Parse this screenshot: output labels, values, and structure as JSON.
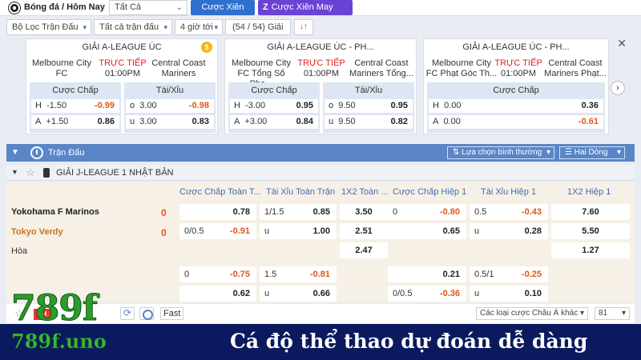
{
  "topbar": {
    "title": "Bóng đá / Hôm Nay",
    "filter_select": "Tất Cả",
    "btn_xien": "Cược Xiên",
    "btn_xien_may_man": "Cược Xiên May Mắn"
  },
  "filters": {
    "loc_tran": "Bộ Lọc Trận Đấu",
    "tat_ca_tran": "Tất cả trận đấu",
    "gio_toi": "4 giờ tới",
    "giai": "(54 / 54) Giải"
  },
  "cards": [
    {
      "league": "GIẢI A-LEAGUE ÚC",
      "home": "Melbourne City FC",
      "away": "Central Coast Mariners",
      "live": "TRỰC TIẾP",
      "time": "01:00PM",
      "hdp_label": "Cược Chấp",
      "ou_label": "Tài/Xỉu",
      "hdp": [
        [
          "H",
          "-1.50",
          "-0.99"
        ],
        [
          "A",
          "+1.50",
          "0.86"
        ]
      ],
      "ou": [
        [
          "o",
          "3.00",
          "-0.98"
        ],
        [
          "u",
          "3.00",
          "0.83"
        ]
      ]
    },
    {
      "league": "GIẢI A-LEAGUE ÚC - PH...",
      "home": "Melbourne City FC Tổng Số Phạ...",
      "away": "Central Coast Mariners Tổng...",
      "live": "TRỰC TIẾP",
      "time": "01:00PM",
      "hdp_label": "Cược Chấp",
      "ou_label": "Tài/Xỉu",
      "hdp": [
        [
          "H",
          "-3.00",
          "0.95"
        ],
        [
          "A",
          "+3.00",
          "0.84"
        ]
      ],
      "ou": [
        [
          "o",
          "9.50",
          "0.95"
        ],
        [
          "u",
          "9.50",
          "0.82"
        ]
      ]
    },
    {
      "league": "GIẢI A-LEAGUE ÚC - PH...",
      "home": "Melbourne City FC Phạt Góc Th...",
      "away": "Central Coast Mariners Phạt...",
      "live": "TRỰC TIẾP",
      "time": "01:00PM",
      "hdp_label": "Cược Chấp",
      "hdp": [
        [
          "H",
          "0.00",
          "0.36"
        ],
        [
          "A",
          "0.00",
          "-0.61"
        ]
      ]
    }
  ],
  "match_section": {
    "title": "Trận Đấu",
    "sort_select": "Lựa chọn bình thường",
    "lines_select": "Hai Dòng",
    "league": "GIẢI J-LEAGUE 1 NHẬT BẢN"
  },
  "columns": [
    "Cược Chấp Toàn T...",
    "Tài Xỉu Toàn Trận",
    "1X2 Toàn ...",
    "Cược Chấp Hiệp 1",
    "Tài Xỉu Hiệp 1",
    "1X2 Hiệp 1"
  ],
  "match": {
    "home": "Yokohama F Marinos",
    "away": "Tokyo Verdy",
    "home_score": "0",
    "away_score": "0",
    "draw": "Hòa",
    "r1": {
      "hdp_k": "",
      "hdp_v": "0.78",
      "ou_k": "1/1.5",
      "ou_v": "0.85",
      "x12": "3.50",
      "h1hdp_k": "0",
      "h1hdp_v": "-0.80",
      "h1ou_k": "0.5",
      "h1ou_v": "-0.43",
      "h1x12": "7.60"
    },
    "r2": {
      "hdp_k": "0/0.5",
      "hdp_v": "-0.91",
      "ou_k": "u",
      "ou_v": "1.00",
      "x12": "2.51",
      "h1hdp_k": "",
      "h1hdp_v": "0.65",
      "h1ou_k": "u",
      "h1ou_v": "0.28",
      "h1x12": "5.50"
    },
    "r3": {
      "x12": "2.47",
      "h1x12": "1.27"
    },
    "r4": {
      "hdp_k": "0",
      "hdp_v": "-0.75",
      "ou_k": "1.5",
      "ou_v": "-0.81",
      "h1hdp_k": "",
      "h1hdp_v": "0.21",
      "h1ou_k": "0.5/1",
      "h1ou_v": "-0.25"
    },
    "r5": {
      "hdp_k": "",
      "hdp_v": "0.62",
      "ou_k": "u",
      "ou_v": "0.66",
      "h1hdp_k": "0/0.5",
      "h1hdp_v": "-0.36",
      "h1ou_k": "u",
      "h1ou_v": "0.10"
    }
  },
  "bottombar": {
    "badge": "1H",
    "fast": "Fast",
    "odds_type": "Các loại cược Châu Á khác",
    "count": "81"
  },
  "banner": {
    "logo": "789f",
    "domain": "789f.uno",
    "tagline": "Cá độ thể thao dự đoán dễ dàng"
  },
  "colors": {
    "accent": "#2f6fd0",
    "purple": "#6a42d6",
    "negative": "#e0561b",
    "live": "#dd2222",
    "header": "#5a86c8",
    "banner": "#0b1a5e"
  }
}
